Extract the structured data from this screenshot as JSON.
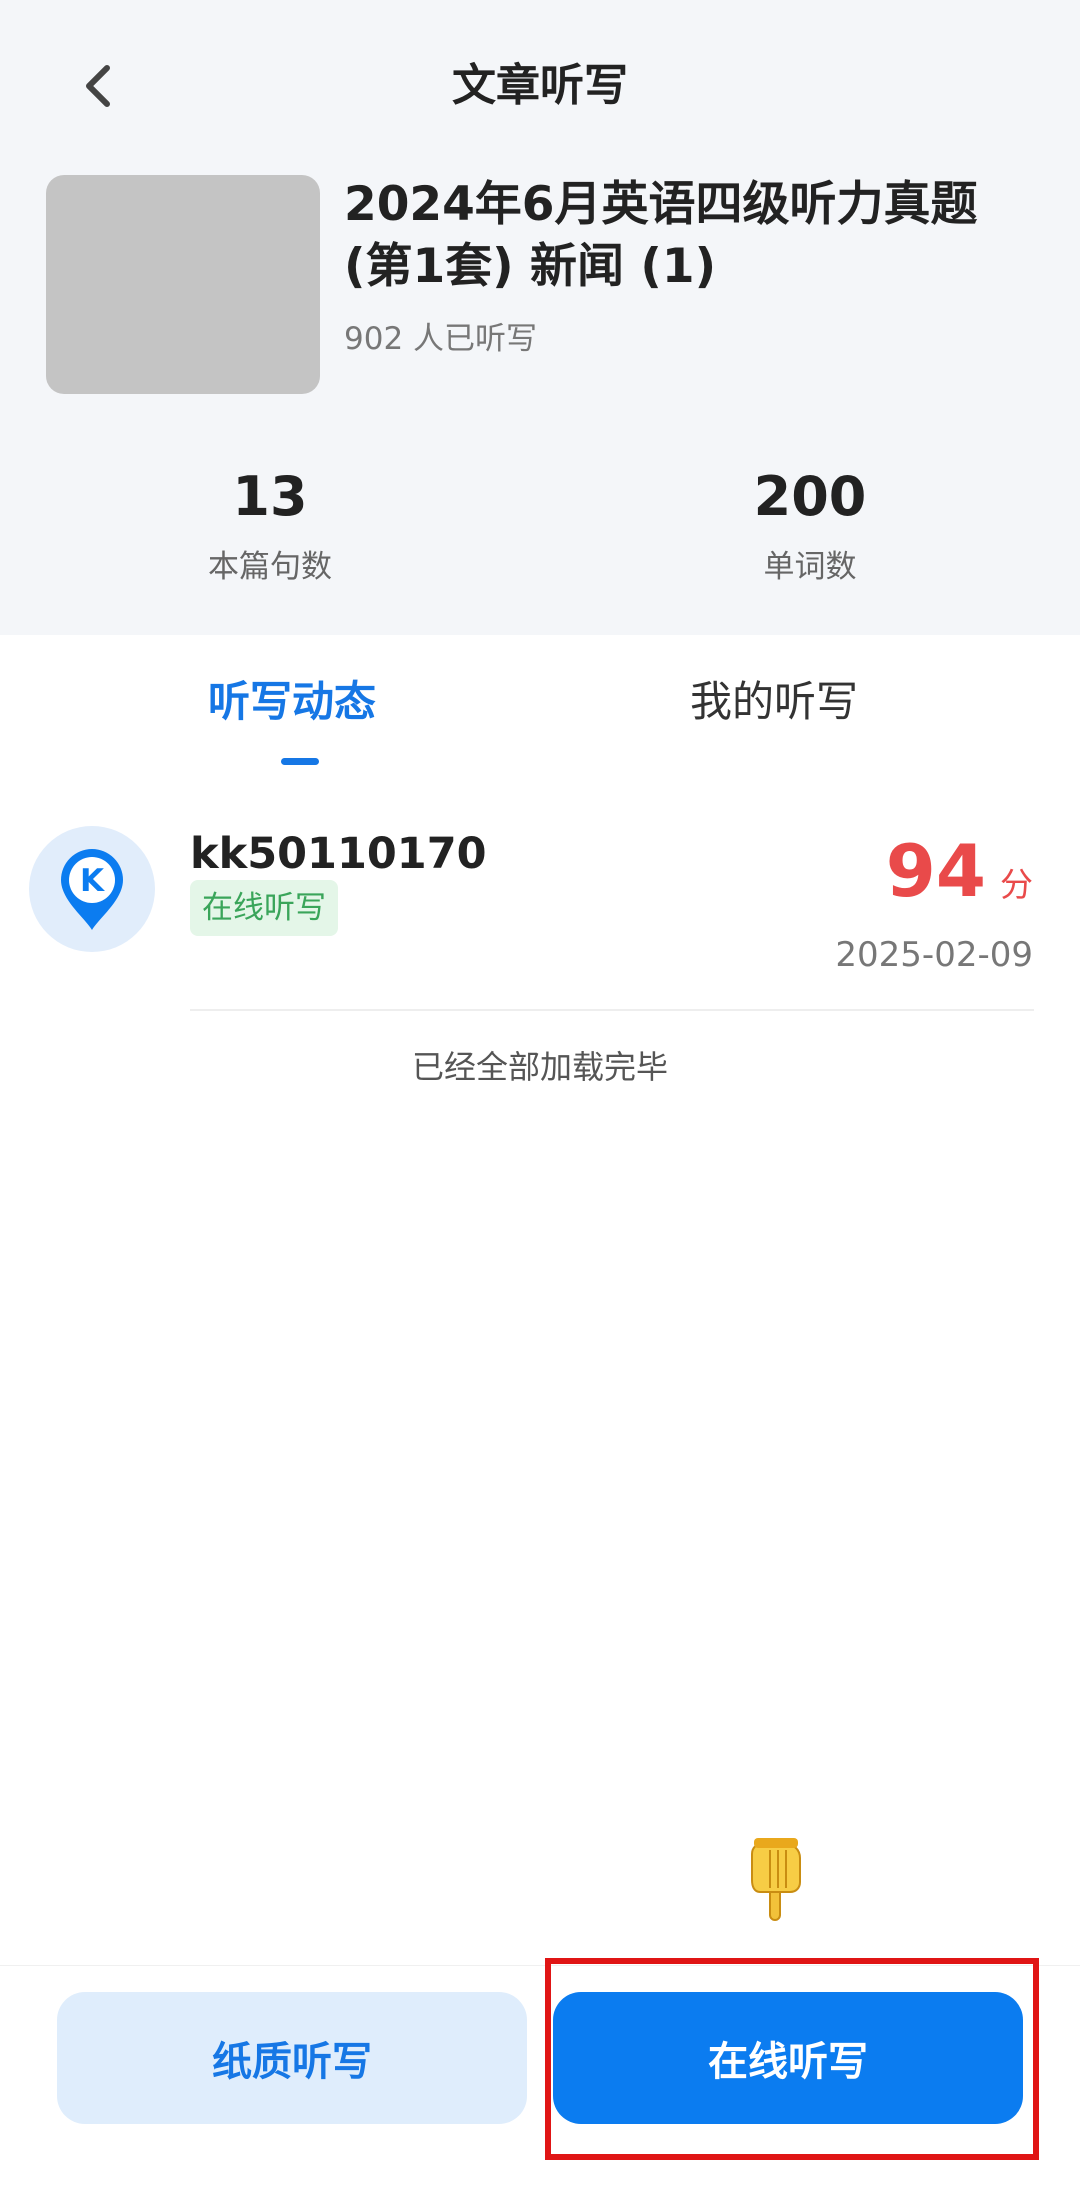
{
  "nav": {
    "title": "文章听写",
    "back_icon": "chevron-left-icon"
  },
  "article": {
    "title": "2024年6月英语四级听力真题 (第1套) 新闻 (1)",
    "readers": "902 人已听写"
  },
  "stats": [
    {
      "value": "13",
      "label": "本篇句数"
    },
    {
      "value": "200",
      "label": "单词数"
    }
  ],
  "tabs": [
    {
      "label": "听写动态",
      "active": true
    },
    {
      "label": "我的听写",
      "active": false
    }
  ],
  "records": [
    {
      "username": "kk50110170",
      "mode": "在线听写",
      "score": "94",
      "score_unit": "分",
      "date": "2025-02-09",
      "avatar_icon": "k-location-pin-icon"
    }
  ],
  "list_footer": "已经全部加载完毕",
  "actions": {
    "paper": "纸质听写",
    "online": "在线听写"
  },
  "colors": {
    "accent": "#1677e5",
    "score": "#e94a4a",
    "tag_green": "#3aa55a",
    "highlight": "#e01515"
  }
}
